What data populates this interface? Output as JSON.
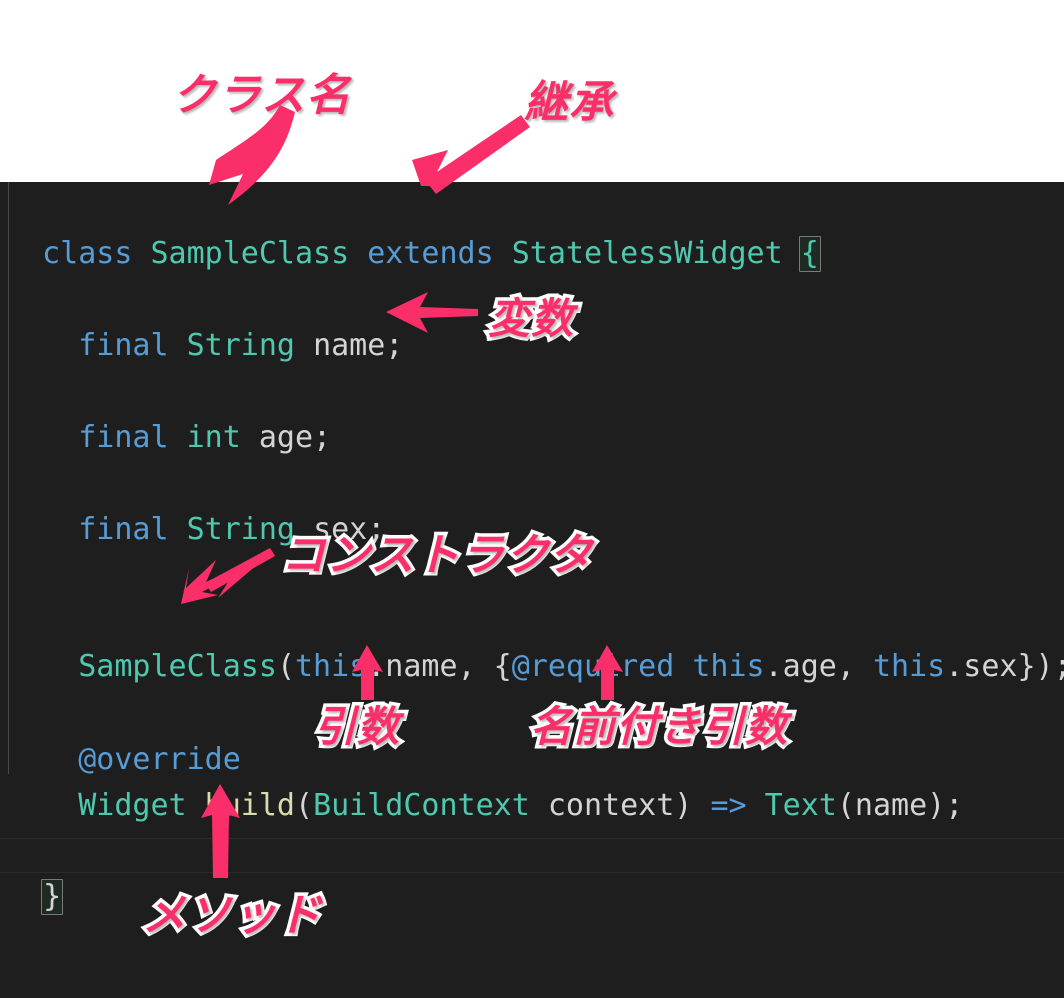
{
  "editor": {
    "language": "dart",
    "background_color": "#1e1e1e",
    "header_background_color": "#ffffff",
    "accent_color": "#fa2f6a",
    "code_lines": [
      {
        "id": "line-class-decl",
        "text": "class SampleClass extends StatelessWidget {",
        "tokens": [
          {
            "t": "class",
            "c": "kw"
          },
          {
            "t": " ",
            "c": "plain"
          },
          {
            "t": "SampleClass",
            "c": "type"
          },
          {
            "t": " ",
            "c": "plain"
          },
          {
            "t": "extends",
            "c": "kw"
          },
          {
            "t": " ",
            "c": "plain"
          },
          {
            "t": "StatelessWidget",
            "c": "type"
          },
          {
            "t": " ",
            "c": "plain"
          },
          {
            "t": "{",
            "c": "bracket"
          }
        ]
      },
      {
        "id": "line-field-name",
        "text": "  final String name;",
        "tokens": [
          {
            "t": "  ",
            "c": "plain"
          },
          {
            "t": "final",
            "c": "kw"
          },
          {
            "t": " ",
            "c": "plain"
          },
          {
            "t": "String",
            "c": "type"
          },
          {
            "t": " ",
            "c": "plain"
          },
          {
            "t": "name;",
            "c": "plain"
          }
        ]
      },
      {
        "id": "line-field-age",
        "text": "  final int age;",
        "tokens": [
          {
            "t": "  ",
            "c": "plain"
          },
          {
            "t": "final",
            "c": "kw"
          },
          {
            "t": " ",
            "c": "plain"
          },
          {
            "t": "int",
            "c": "type"
          },
          {
            "t": " ",
            "c": "plain"
          },
          {
            "t": "age;",
            "c": "plain"
          }
        ]
      },
      {
        "id": "line-field-sex",
        "text": "  final String sex;",
        "tokens": [
          {
            "t": "  ",
            "c": "plain"
          },
          {
            "t": "final",
            "c": "kw"
          },
          {
            "t": " ",
            "c": "plain"
          },
          {
            "t": "String",
            "c": "type"
          },
          {
            "t": " ",
            "c": "plain"
          },
          {
            "t": "sex;",
            "c": "plain"
          }
        ]
      },
      {
        "id": "line-constructor",
        "text": "  SampleClass(this.name, {@required this.age, this.sex});",
        "tokens": [
          {
            "t": "  ",
            "c": "plain"
          },
          {
            "t": "SampleClass",
            "c": "type"
          },
          {
            "t": "(",
            "c": "plain"
          },
          {
            "t": "this",
            "c": "kw"
          },
          {
            "t": ".name, {",
            "c": "plain"
          },
          {
            "t": "@required",
            "c": "anno"
          },
          {
            "t": " ",
            "c": "plain"
          },
          {
            "t": "this",
            "c": "kw"
          },
          {
            "t": ".age, ",
            "c": "plain"
          },
          {
            "t": "this",
            "c": "kw"
          },
          {
            "t": ".sex});",
            "c": "plain"
          }
        ]
      },
      {
        "id": "line-override",
        "text": "  @override",
        "tokens": [
          {
            "t": "  ",
            "c": "plain"
          },
          {
            "t": "@override",
            "c": "anno"
          }
        ]
      },
      {
        "id": "line-build",
        "text": "  Widget build(BuildContext context) => Text(name);",
        "tokens": [
          {
            "t": "  ",
            "c": "plain"
          },
          {
            "t": "Widget",
            "c": "type"
          },
          {
            "t": " ",
            "c": "plain"
          },
          {
            "t": "build",
            "c": "fn"
          },
          {
            "t": "(",
            "c": "plain"
          },
          {
            "t": "BuildContext",
            "c": "type"
          },
          {
            "t": " context) ",
            "c": "plain"
          },
          {
            "t": "=>",
            "c": "kw"
          },
          {
            "t": " ",
            "c": "plain"
          },
          {
            "t": "Text",
            "c": "type"
          },
          {
            "t": "(name);",
            "c": "plain"
          }
        ]
      },
      {
        "id": "line-close-brace",
        "text": "}",
        "tokens": [
          {
            "t": "}",
            "c": "bracket"
          }
        ]
      }
    ]
  },
  "annotations": [
    {
      "id": "annot-class-name",
      "label": "クラス名",
      "points_to": "SampleClass"
    },
    {
      "id": "annot-inheritance",
      "label": "継承",
      "points_to": "extends"
    },
    {
      "id": "annot-variable",
      "label": "変数",
      "points_to": "final String name;"
    },
    {
      "id": "annot-constructor",
      "label": "コンストラクタ",
      "points_to": "SampleClass(...)"
    },
    {
      "id": "annot-argument",
      "label": "引数",
      "points_to": "this.name"
    },
    {
      "id": "annot-named-argument",
      "label": "名前付き引数",
      "points_to": "{@required this.age, this.sex}"
    },
    {
      "id": "annot-method",
      "label": "メソッド",
      "points_to": "build"
    }
  ]
}
